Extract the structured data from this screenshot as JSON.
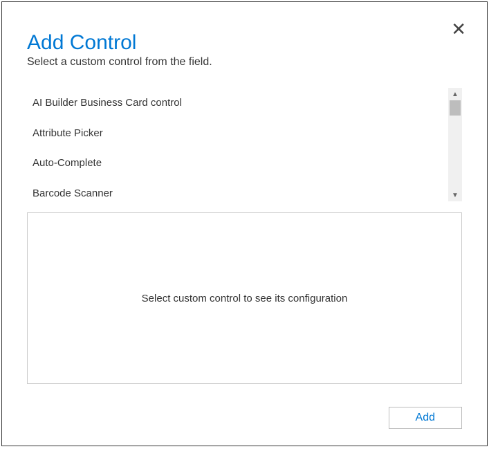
{
  "dialog": {
    "title": "Add Control",
    "subtitle": "Select a custom control from the field.",
    "close_icon": "✕"
  },
  "controls": {
    "items": [
      {
        "label": "AI Builder Business Card control"
      },
      {
        "label": "Attribute Picker"
      },
      {
        "label": "Auto-Complete"
      },
      {
        "label": "Barcode Scanner"
      }
    ]
  },
  "config": {
    "placeholder": "Select custom control to see its configuration"
  },
  "footer": {
    "add_label": "Add"
  },
  "scrollbar": {
    "up": "▲",
    "down": "▼"
  }
}
